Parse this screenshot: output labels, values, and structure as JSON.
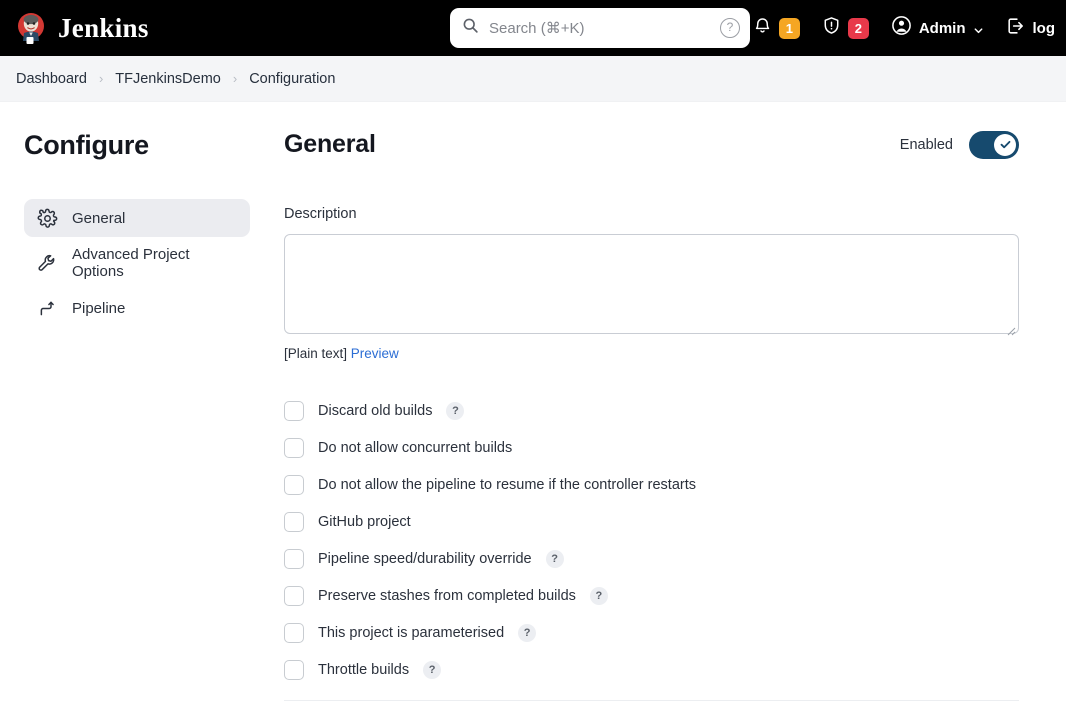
{
  "header": {
    "brand": "Jenkins",
    "logo_icon": "jenkins-butler-logo",
    "search": {
      "placeholder": "Search (⌘+K)",
      "value": "",
      "icon": "search-icon",
      "help_icon": "help-circle-icon"
    },
    "notifications": {
      "icon": "bell-icon",
      "count": "1",
      "color": "#f5a623"
    },
    "security": {
      "icon": "shield-alert-icon",
      "count": "2",
      "color": "#e8394a"
    },
    "user": {
      "icon": "user-circle-icon",
      "label": "Admin",
      "chevron": "chevron-down-icon"
    },
    "logout": {
      "icon": "logout-icon",
      "label": "log"
    }
  },
  "breadcrumb": {
    "separator": "›",
    "items": [
      {
        "label": "Dashboard"
      },
      {
        "label": "TFJenkinsDemo"
      },
      {
        "label": "Configuration"
      }
    ]
  },
  "sidebar": {
    "title": "Configure",
    "items": [
      {
        "label": "General",
        "icon": "gear-icon",
        "active": true
      },
      {
        "label": "Advanced Project Options",
        "icon": "wrench-icon",
        "active": false
      },
      {
        "label": "Pipeline",
        "icon": "pipeline-icon",
        "active": false
      }
    ]
  },
  "main": {
    "title": "General",
    "enabled": {
      "label": "Enabled",
      "state": "on",
      "track_color": "#164a6e",
      "check_icon": "check-icon"
    },
    "description": {
      "label": "Description",
      "value": "",
      "format_note": "[Plain text]",
      "preview_label": "Preview",
      "preview_color": "#2b6dd4"
    },
    "options": [
      {
        "label": "Discard old builds",
        "checked": false,
        "help": "?"
      },
      {
        "label": "Do not allow concurrent builds",
        "checked": false,
        "help": ""
      },
      {
        "label": "Do not allow the pipeline to resume if the controller restarts",
        "checked": false,
        "help": ""
      },
      {
        "label": "GitHub project",
        "checked": false,
        "help": ""
      },
      {
        "label": "Pipeline speed/durability override",
        "checked": false,
        "help": "?"
      },
      {
        "label": "Preserve stashes from completed builds",
        "checked": false,
        "help": "?"
      },
      {
        "label": "This project is parameterised",
        "checked": false,
        "help": "?"
      },
      {
        "label": "Throttle builds",
        "checked": false,
        "help": "?"
      }
    ]
  }
}
